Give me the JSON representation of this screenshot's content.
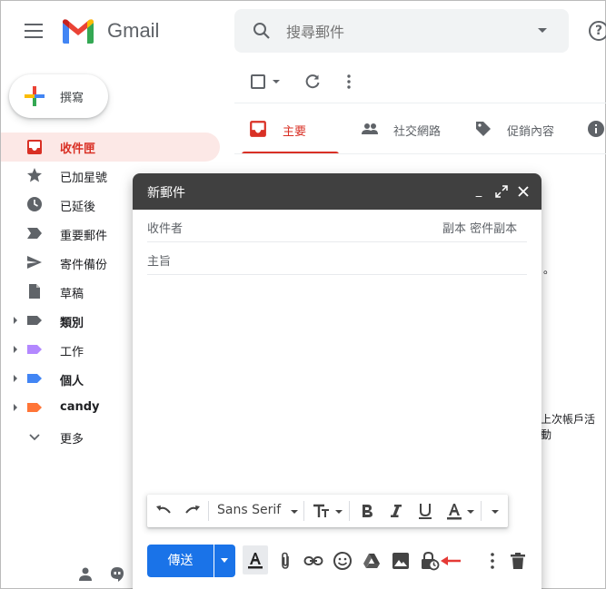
{
  "app": {
    "brand": "Gmail"
  },
  "search": {
    "placeholder": "搜尋郵件"
  },
  "compose_button": {
    "label": "撰寫"
  },
  "sidebar": {
    "items": [
      {
        "label": "收件匣",
        "icon": "inbox-icon",
        "active": true
      },
      {
        "label": "已加星號",
        "icon": "star-icon"
      },
      {
        "label": "已延後",
        "icon": "clock-icon"
      },
      {
        "label": "重要郵件",
        "icon": "important-icon"
      },
      {
        "label": "寄件備份",
        "icon": "send-icon"
      },
      {
        "label": "草稿",
        "icon": "draft-icon"
      },
      {
        "label": "類別",
        "icon": "label-icon",
        "bold": true,
        "color": "#5f6368"
      },
      {
        "label": "工作",
        "icon": "label-icon",
        "color": "#b388ff"
      },
      {
        "label": "個人",
        "icon": "label-icon",
        "color": "#4285f4"
      },
      {
        "label": "candy",
        "icon": "label-icon",
        "bold": true,
        "color": "#ff7537"
      },
      {
        "label": "更多",
        "icon": "chevron-down-icon"
      }
    ]
  },
  "tabs": [
    {
      "label": "主要",
      "icon": "inbox-icon",
      "active": true
    },
    {
      "label": "社交網路",
      "icon": "people-icon"
    },
    {
      "label": "促銷內容",
      "icon": "tag-icon"
    }
  ],
  "background_text": {
    "period": "。",
    "last_activity": "上次帳戶活動"
  },
  "compose": {
    "title": "新郵件",
    "to_label": "收件者",
    "cc_bcc": "副本 密件副本",
    "subject_placeholder": "主旨",
    "font_name": "Sans Serif",
    "send_label": "傳送"
  },
  "colors": {
    "accent_red": "#d93025",
    "send_blue": "#1a73e8",
    "compose_header": "#404040"
  }
}
